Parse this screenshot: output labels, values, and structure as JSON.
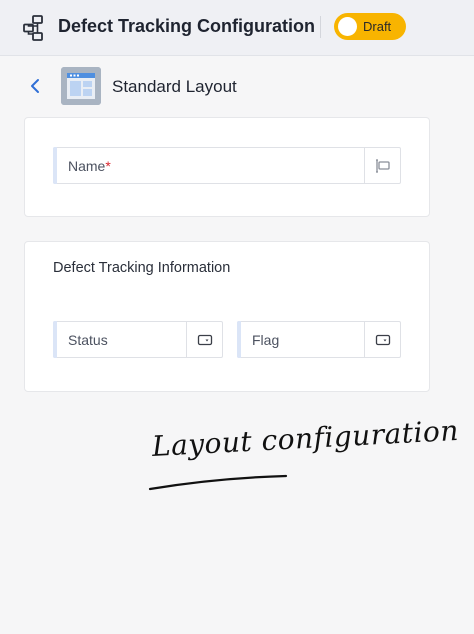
{
  "header": {
    "title": "Defect Tracking Configuration",
    "status_label": "Draft",
    "icon": "workflow-icon"
  },
  "subheader": {
    "title": "Standard Layout",
    "back_icon": "chevron-left-icon",
    "thumb_icon": "layout-thumbnail-icon"
  },
  "cards": {
    "main": {
      "fields": [
        {
          "label": "Name",
          "required_mark": "*",
          "icon": "field-edit-icon"
        }
      ]
    },
    "section": {
      "title": "Defect Tracking Information",
      "fields": [
        {
          "label": "Status",
          "icon": "dropdown-icon"
        },
        {
          "label": "Flag",
          "icon": "dropdown-icon"
        }
      ]
    }
  },
  "annotation": {
    "text": "Layout configuration"
  },
  "colors": {
    "accent": "#f8b400",
    "back": "#2f6fd6",
    "field_stripe": "#dbe5f7"
  }
}
